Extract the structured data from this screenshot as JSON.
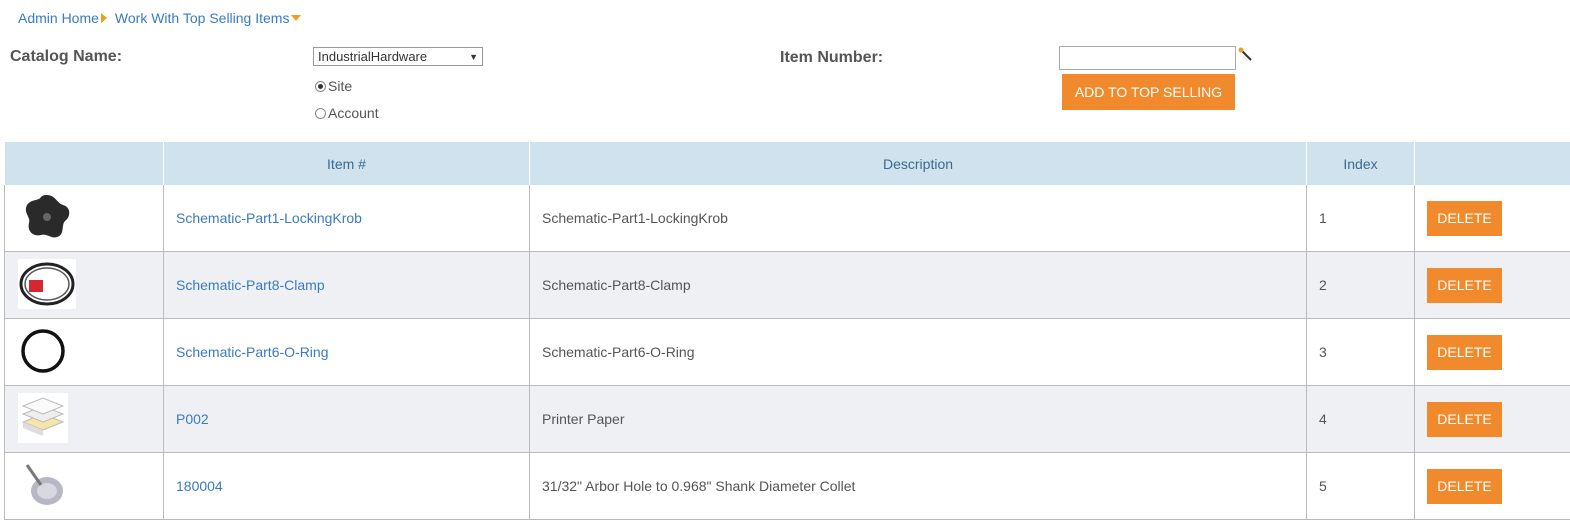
{
  "breadcrumb": {
    "home": "Admin Home",
    "current": "Work With Top Selling Items"
  },
  "form": {
    "catalog_label": "Catalog Name:",
    "catalog_value": "IndustrialHardware",
    "radio_site": "Site",
    "radio_account": "Account",
    "selected_radio": "Site",
    "item_label": "Item Number:",
    "item_value": "",
    "add_button": "ADD TO TOP SELLING"
  },
  "table": {
    "headers": [
      "",
      "Item #",
      "Description",
      "Index",
      ""
    ],
    "delete_label": "DELETE",
    "rows": [
      {
        "item": "Schematic-Part1-LockingKrob",
        "description": "Schematic-Part1-LockingKrob",
        "index": "1",
        "image": "locking-knob-image"
      },
      {
        "item": "Schematic-Part8-Clamp",
        "description": "Schematic-Part8-Clamp",
        "index": "2",
        "image": "clamp-image"
      },
      {
        "item": "Schematic-Part6-O-Ring",
        "description": "Schematic-Part6-O-Ring",
        "index": "3",
        "image": "o-ring-image"
      },
      {
        "item": "P002",
        "description": "Printer Paper",
        "index": "4",
        "image": "printer-paper-image"
      },
      {
        "item": "180004",
        "description": "31/32\" Arbor Hole to 0.968\" Shank Diameter Collet",
        "index": "5",
        "image": "collet-image"
      }
    ]
  },
  "colors": {
    "accent": "#f08a2c",
    "link": "#3a7bbf",
    "header_bg": "#cfe2ee"
  }
}
